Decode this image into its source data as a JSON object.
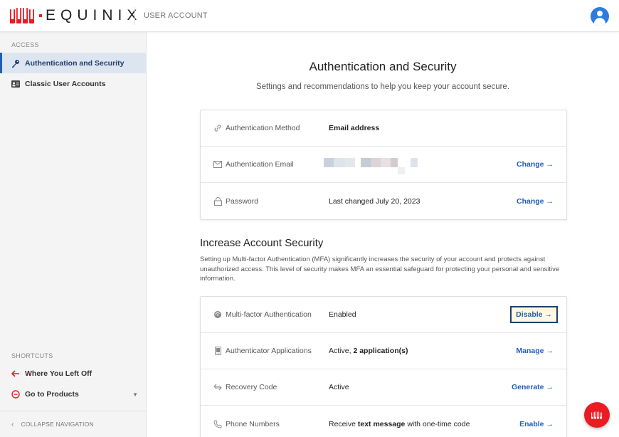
{
  "header": {
    "logo_text": "EQUINIX",
    "app_name": "USER ACCOUNT",
    "brand_color": "#e91c24",
    "avatar_color": "#2f7bde"
  },
  "sidebar": {
    "section_access": "ACCESS",
    "items": [
      {
        "label": "Authentication and Security",
        "icon": "key-icon",
        "active": true
      },
      {
        "label": "Classic User Accounts",
        "icon": "id-card-icon",
        "active": false
      }
    ],
    "section_shortcuts": "SHORTCUTS",
    "shortcuts": [
      {
        "label": "Where You Left Off",
        "icon": "arrow-left-icon"
      },
      {
        "label": "Go to Products",
        "icon": "products-icon"
      }
    ],
    "collapse_label": "COLLAPSE NAVIGATION"
  },
  "main": {
    "title": "Authentication and Security",
    "subtitle": "Settings and recommendations to help you keep your account secure.",
    "auth_rows": [
      {
        "label": "Authentication Method",
        "icon": "link-icon",
        "value": "Email address",
        "action": ""
      },
      {
        "label": "Authentication Email",
        "icon": "envelope-icon",
        "value": "",
        "action": "Change"
      },
      {
        "label": "Password",
        "icon": "lock-icon",
        "value": "Last changed July 20, 2023",
        "action": "Change"
      }
    ],
    "security_heading": "Increase Account Security",
    "security_text": "Setting up Multi-factor Authentication (MFA) significantly increases the security of your account and protects against unauthorized access. This level of security makes MFA an essential safeguard for protecting your personal and sensitive information.",
    "mfa_rows": [
      {
        "label": "Multi-factor Authentication",
        "icon": "fingerprint-icon",
        "value_pre": "Enabled",
        "value_bold": "",
        "value_post": "",
        "action": "Disable"
      },
      {
        "label": "Authenticator Applications",
        "icon": "phone-icon",
        "value_pre": "Active, ",
        "value_bold": "2 application(s)",
        "value_post": "",
        "action": "Manage"
      },
      {
        "label": "Recovery Code",
        "icon": "recovery-icon",
        "value_pre": "Active",
        "value_bold": "",
        "value_post": "",
        "action": "Generate"
      },
      {
        "label": "Phone Numbers",
        "icon": "handset-icon",
        "value_pre": "Receive ",
        "value_bold": "text message",
        "value_post": " with one-time code",
        "action": "Enable"
      }
    ]
  }
}
